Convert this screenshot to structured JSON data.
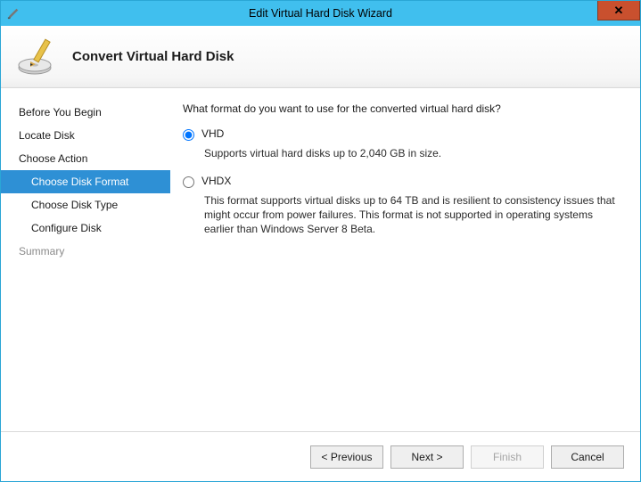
{
  "window": {
    "title": "Edit Virtual Hard Disk Wizard"
  },
  "header": {
    "heading": "Convert Virtual Hard Disk"
  },
  "sidebar": {
    "steps": [
      {
        "label": "Before You Begin",
        "indent": false,
        "selected": false,
        "disabled": false
      },
      {
        "label": "Locate Disk",
        "indent": false,
        "selected": false,
        "disabled": false
      },
      {
        "label": "Choose Action",
        "indent": false,
        "selected": false,
        "disabled": false
      },
      {
        "label": "Choose Disk Format",
        "indent": true,
        "selected": true,
        "disabled": false
      },
      {
        "label": "Choose Disk Type",
        "indent": true,
        "selected": false,
        "disabled": false
      },
      {
        "label": "Configure Disk",
        "indent": true,
        "selected": false,
        "disabled": false
      },
      {
        "label": "Summary",
        "indent": false,
        "selected": false,
        "disabled": true
      }
    ]
  },
  "content": {
    "question": "What format do you want to use for the converted virtual hard disk?",
    "options": [
      {
        "value": "vhd",
        "label": "VHD",
        "description": "Supports virtual hard disks up to 2,040 GB in size.",
        "checked": true
      },
      {
        "value": "vhdx",
        "label": "VHDX",
        "description": "This format supports virtual disks up to 64 TB and is resilient to consistency issues that might occur from power failures. This format is not supported in operating systems earlier than Windows Server 8 Beta.",
        "checked": false
      }
    ]
  },
  "footer": {
    "previous": "< Previous",
    "next": "Next >",
    "finish": "Finish",
    "cancel": "Cancel"
  }
}
